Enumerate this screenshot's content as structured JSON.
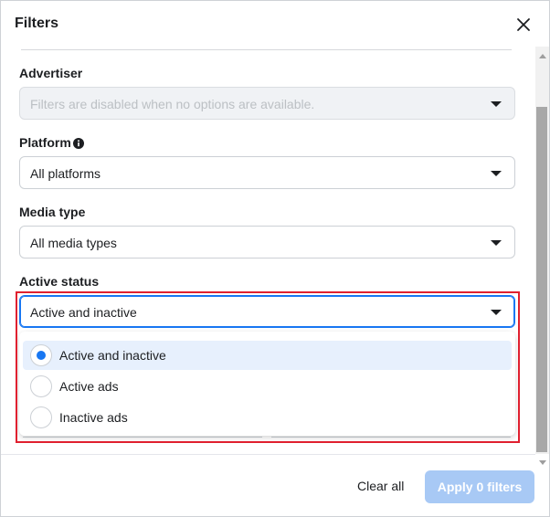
{
  "dialog": {
    "title": "Filters"
  },
  "fields": {
    "advertiser": {
      "label": "Advertiser",
      "placeholder": "Filters are disabled when no options are available."
    },
    "platform": {
      "label": "Platform",
      "value": "All platforms"
    },
    "media_type": {
      "label": "Media type",
      "value": "All media types"
    },
    "active_status": {
      "label": "Active status",
      "value": "Active and inactive",
      "options": [
        {
          "label": "Active and inactive",
          "selected": true
        },
        {
          "label": "Active ads",
          "selected": false
        },
        {
          "label": "Inactive ads",
          "selected": false
        }
      ]
    }
  },
  "footer": {
    "clear_all": "Clear all",
    "apply": "Apply 0 filters"
  },
  "colors": {
    "accent": "#1877f2",
    "highlight_border": "#e0202f",
    "apply_disabled": "#a8c9f5"
  },
  "icons": {
    "close": "close-icon",
    "info": "info-icon",
    "caret": "caret-down-icon",
    "radio": "radio-icon"
  }
}
